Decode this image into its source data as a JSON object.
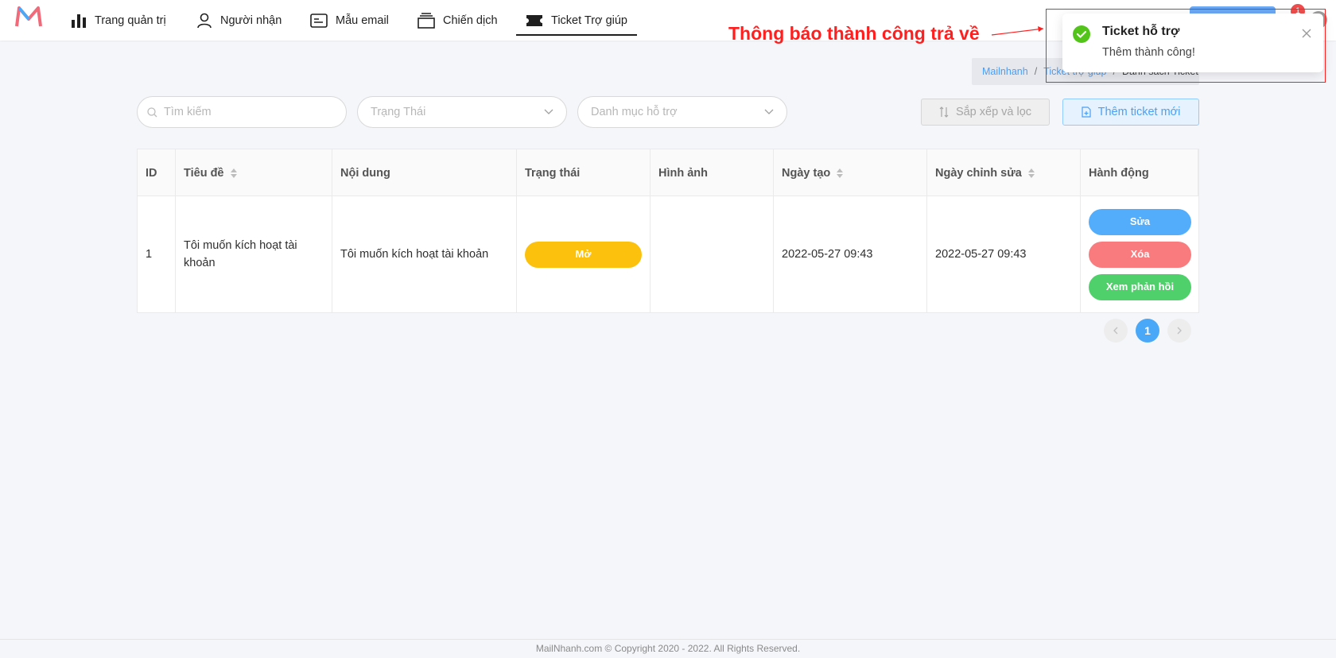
{
  "nav": {
    "items": [
      {
        "label": "Trang quản trị",
        "icon": "bar-chart-icon"
      },
      {
        "label": "Người nhận",
        "icon": "user-icon"
      },
      {
        "label": "Mẫu email",
        "icon": "email-template-icon"
      },
      {
        "label": "Chiến dịch",
        "icon": "campaign-stack-icon"
      },
      {
        "label": "Ticket Trợ giúp",
        "icon": "ticket-icon"
      }
    ],
    "notification_count": "1"
  },
  "breadcrumb": {
    "home": "Mailnhanh",
    "section": "Ticket trợ giúp",
    "current": "Danh sách Ticket"
  },
  "filters": {
    "search_placeholder": "Tìm kiếm",
    "status_placeholder": "Trạng Thái",
    "category_placeholder": "Danh mục hỗ trợ",
    "sort_label": "Sắp xếp và lọc",
    "add_label": "Thêm ticket mới"
  },
  "table": {
    "headers": [
      "ID",
      "Tiêu đề",
      "Nội dung",
      "Trạng thái",
      "Hình ảnh",
      "Ngày tạo",
      "Ngày chỉnh sửa",
      "Hành động"
    ],
    "rows": [
      {
        "id": "1",
        "title": "Tôi muốn kích hoạt tài khoản",
        "content": "Tôi muốn kích hoạt tài khoản",
        "status": "Mở",
        "image": "",
        "created": "2022-05-27 09:43",
        "modified": "2022-05-27 09:43",
        "actions": {
          "edit": "Sửa",
          "delete": "Xóa",
          "view": "Xem phản hồi"
        }
      }
    ]
  },
  "pagination": {
    "current": "1"
  },
  "footer": "MailNhanh.com © Copyright 2020 - 2022. All Rights Reserved.",
  "toast": {
    "title": "Ticket hỗ trợ",
    "message": "Thêm thành công!"
  },
  "annotation": "Thông báo thành công trả về",
  "colors": {
    "accent": "#4aa8f8",
    "status_open": "#fcc10d",
    "edit": "#54adfb",
    "delete": "#fa7b7e",
    "view": "#50d06a",
    "success": "#52c41a",
    "annotation": "#ff1f1f"
  }
}
